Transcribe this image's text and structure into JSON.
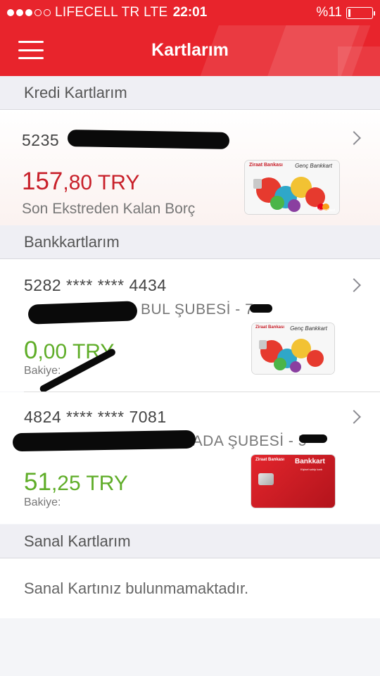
{
  "status": {
    "carrier": "LIFECELL TR  LTE",
    "time": "22:01",
    "battery": "%11",
    "battery_level": 0.11
  },
  "header": {
    "title": "Kartlarım"
  },
  "sections": {
    "credit": "Kredi Kartlarım",
    "bank": "Bankkartlarım",
    "virtual": "Sanal Kartlarım"
  },
  "credit_card": {
    "number": "5235",
    "amount_main": "157",
    "amount_dec": ",80 TRY",
    "label": "Son Ekstreden Kalan Borç",
    "bank": "Ziraat Bankası",
    "card_name": "Genç Bankkart",
    "network": "MasterCard"
  },
  "bank_cards": [
    {
      "number": "5282 **** **** 4434",
      "branch": "BUL ŞUBESİ - 7",
      "amount_main": "0",
      "amount_dec": ",00 TRY",
      "balance_label": "Bakiye:",
      "bank": "Ziraat Bankası",
      "card_name": "Genç Bankkart"
    },
    {
      "number": "4824 **** **** 7081",
      "branch": "RADA ŞUBESİ - 5",
      "amount_main": "51",
      "amount_dec": ",25 TRY",
      "balance_label": "Bakiye:",
      "bank": "Ziraat Bankası",
      "card_name": "Bankkart",
      "card_tagline": "Kişisel sahip kartı"
    }
  ],
  "virtual": {
    "empty_text": "Sanal Kartınız bulunmamaktadır."
  },
  "colors": {
    "brand": "#e8242c",
    "debt": "#c8202a",
    "balance": "#5fad28"
  }
}
